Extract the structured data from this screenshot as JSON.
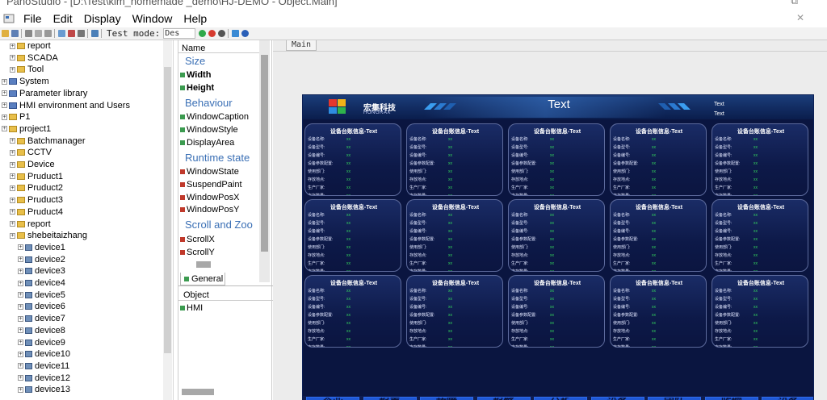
{
  "window": {
    "title": "PanoStudio - [D:\\Test\\kim_homemade _demo\\HJ-DEMO - Object.Main]"
  },
  "menu": [
    "File",
    "Edit",
    "Display",
    "Window",
    "Help"
  ],
  "toolbar": {
    "test_mode_label": "Test mode:",
    "test_mode_value": "Des"
  },
  "tree": {
    "items": [
      {
        "label": "report",
        "indent": 1
      },
      {
        "label": "SCADA",
        "indent": 1
      },
      {
        "label": "Tool",
        "indent": 1
      },
      {
        "label": "System",
        "indent": 0
      },
      {
        "label": "Parameter library",
        "indent": 0
      },
      {
        "label": "HMI environment and Users",
        "indent": 0
      },
      {
        "label": "P1",
        "indent": 0
      },
      {
        "label": "project1",
        "indent": 0
      },
      {
        "label": "Batchmanager",
        "indent": 1
      },
      {
        "label": "CCTV",
        "indent": 1
      },
      {
        "label": "Device",
        "indent": 1
      },
      {
        "label": "Pruduct1",
        "indent": 1
      },
      {
        "label": "Pruduct2",
        "indent": 1
      },
      {
        "label": "Pruduct3",
        "indent": 1
      },
      {
        "label": "Pruduct4",
        "indent": 1
      },
      {
        "label": "report",
        "indent": 1
      },
      {
        "label": "shebeitaizhang",
        "indent": 1
      },
      {
        "label": "device1",
        "indent": 2
      },
      {
        "label": "device2",
        "indent": 2
      },
      {
        "label": "device3",
        "indent": 2
      },
      {
        "label": "device4",
        "indent": 2
      },
      {
        "label": "device5",
        "indent": 2
      },
      {
        "label": "device6",
        "indent": 2
      },
      {
        "label": "device7",
        "indent": 2
      },
      {
        "label": "device8",
        "indent": 2
      },
      {
        "label": "device9",
        "indent": 2
      },
      {
        "label": "device10",
        "indent": 2
      },
      {
        "label": "device11",
        "indent": 2
      },
      {
        "label": "device12",
        "indent": 2
      },
      {
        "label": "device13",
        "indent": 2
      }
    ]
  },
  "properties": {
    "header": "Name",
    "categories": {
      "size": "Size",
      "behaviour": "Behaviour",
      "runtime": "Runtime state",
      "scroll": "Scroll and Zoo"
    },
    "items": {
      "width": "Width",
      "height": "Height",
      "window_caption": "WindowCaption",
      "window_style": "WindowStyle",
      "display_area": "DisplayArea",
      "window_state": "WindowState",
      "suspend_paint": "SuspendPaint",
      "window_pos_x": "WindowPosX",
      "window_pos_y": "WindowPosY",
      "scroll_x": "ScrollX",
      "scroll_y": "ScrollY"
    },
    "tab": "General"
  },
  "object_list": {
    "title": "Object",
    "items": [
      "HMI"
    ]
  },
  "main": {
    "tab": "Main"
  },
  "hmi": {
    "brand_cn": "宏集科技",
    "brand_en": "HONGRAX",
    "title": "Text",
    "right_text_1": "Text",
    "right_text_2": "Text",
    "card_title": "设备台账信息-Text",
    "card_rows": [
      "设备名称:",
      "设备型号:",
      "设备编号:",
      "设备参数配置:",
      "使用部门:",
      "存放地点:",
      "生产厂家:",
      "库存数量:"
    ],
    "card_value": "xx",
    "footer_buttons": [
      "企业",
      "报表",
      "故障",
      "报警",
      "分析",
      "设备",
      "团队",
      "监控",
      "设备"
    ]
  },
  "colors": {
    "hmi_bg": "#0a1540",
    "card_title": "#ffffff",
    "value_green": "#34d65c",
    "footer_button": "#1f58d6",
    "prop_category": "#3a6fb5"
  }
}
